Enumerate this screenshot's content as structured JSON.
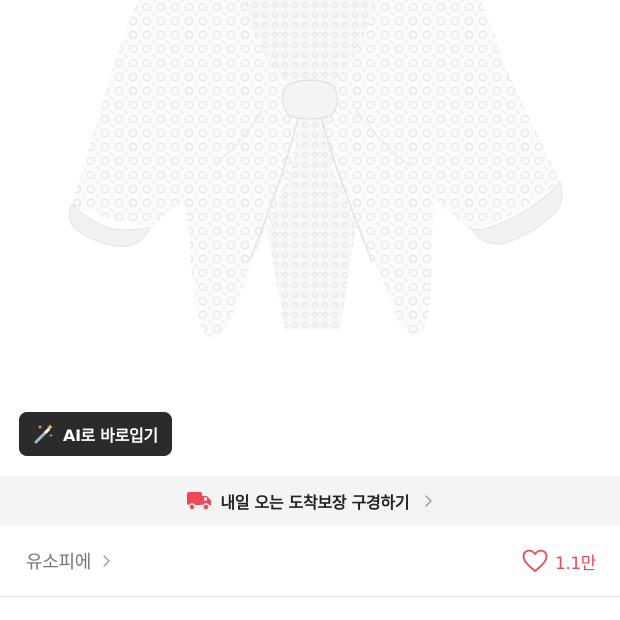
{
  "product": {
    "image_alt": "white lace bolero cardigan"
  },
  "ai_button": {
    "label": "AI로 바로입기",
    "icon": "magic-wand-icon"
  },
  "delivery_banner": {
    "text": "내일 오는 도착보장 구경하기",
    "icon": "truck-icon",
    "accent": "#f0475a"
  },
  "store": {
    "name": "유소피에",
    "icon": "chevron-right-icon"
  },
  "like": {
    "count": "1.1만",
    "icon": "heart-outline-icon",
    "color": "#f0475a"
  }
}
